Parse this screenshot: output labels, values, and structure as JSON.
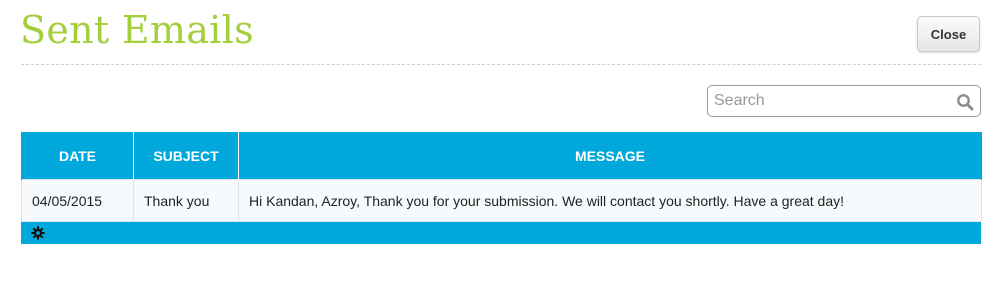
{
  "header": {
    "title": "Sent Emails",
    "close_label": "Close"
  },
  "search": {
    "placeholder": "Search",
    "value": "",
    "icon": "search-icon"
  },
  "table": {
    "columns": [
      "DATE",
      "SUBJECT",
      "MESSAGE"
    ],
    "rows": [
      {
        "date": "04/05/2015",
        "subject": "Thank you",
        "message": "Hi Kandan, Azroy, Thank you for your submission. We will contact you shortly. Have a great day!"
      }
    ]
  },
  "footer": {
    "icon": "gear-icon"
  },
  "colors": {
    "title": "#a3cf3c",
    "header_bg": "#00a8dc",
    "header_text": "#ffffff"
  }
}
